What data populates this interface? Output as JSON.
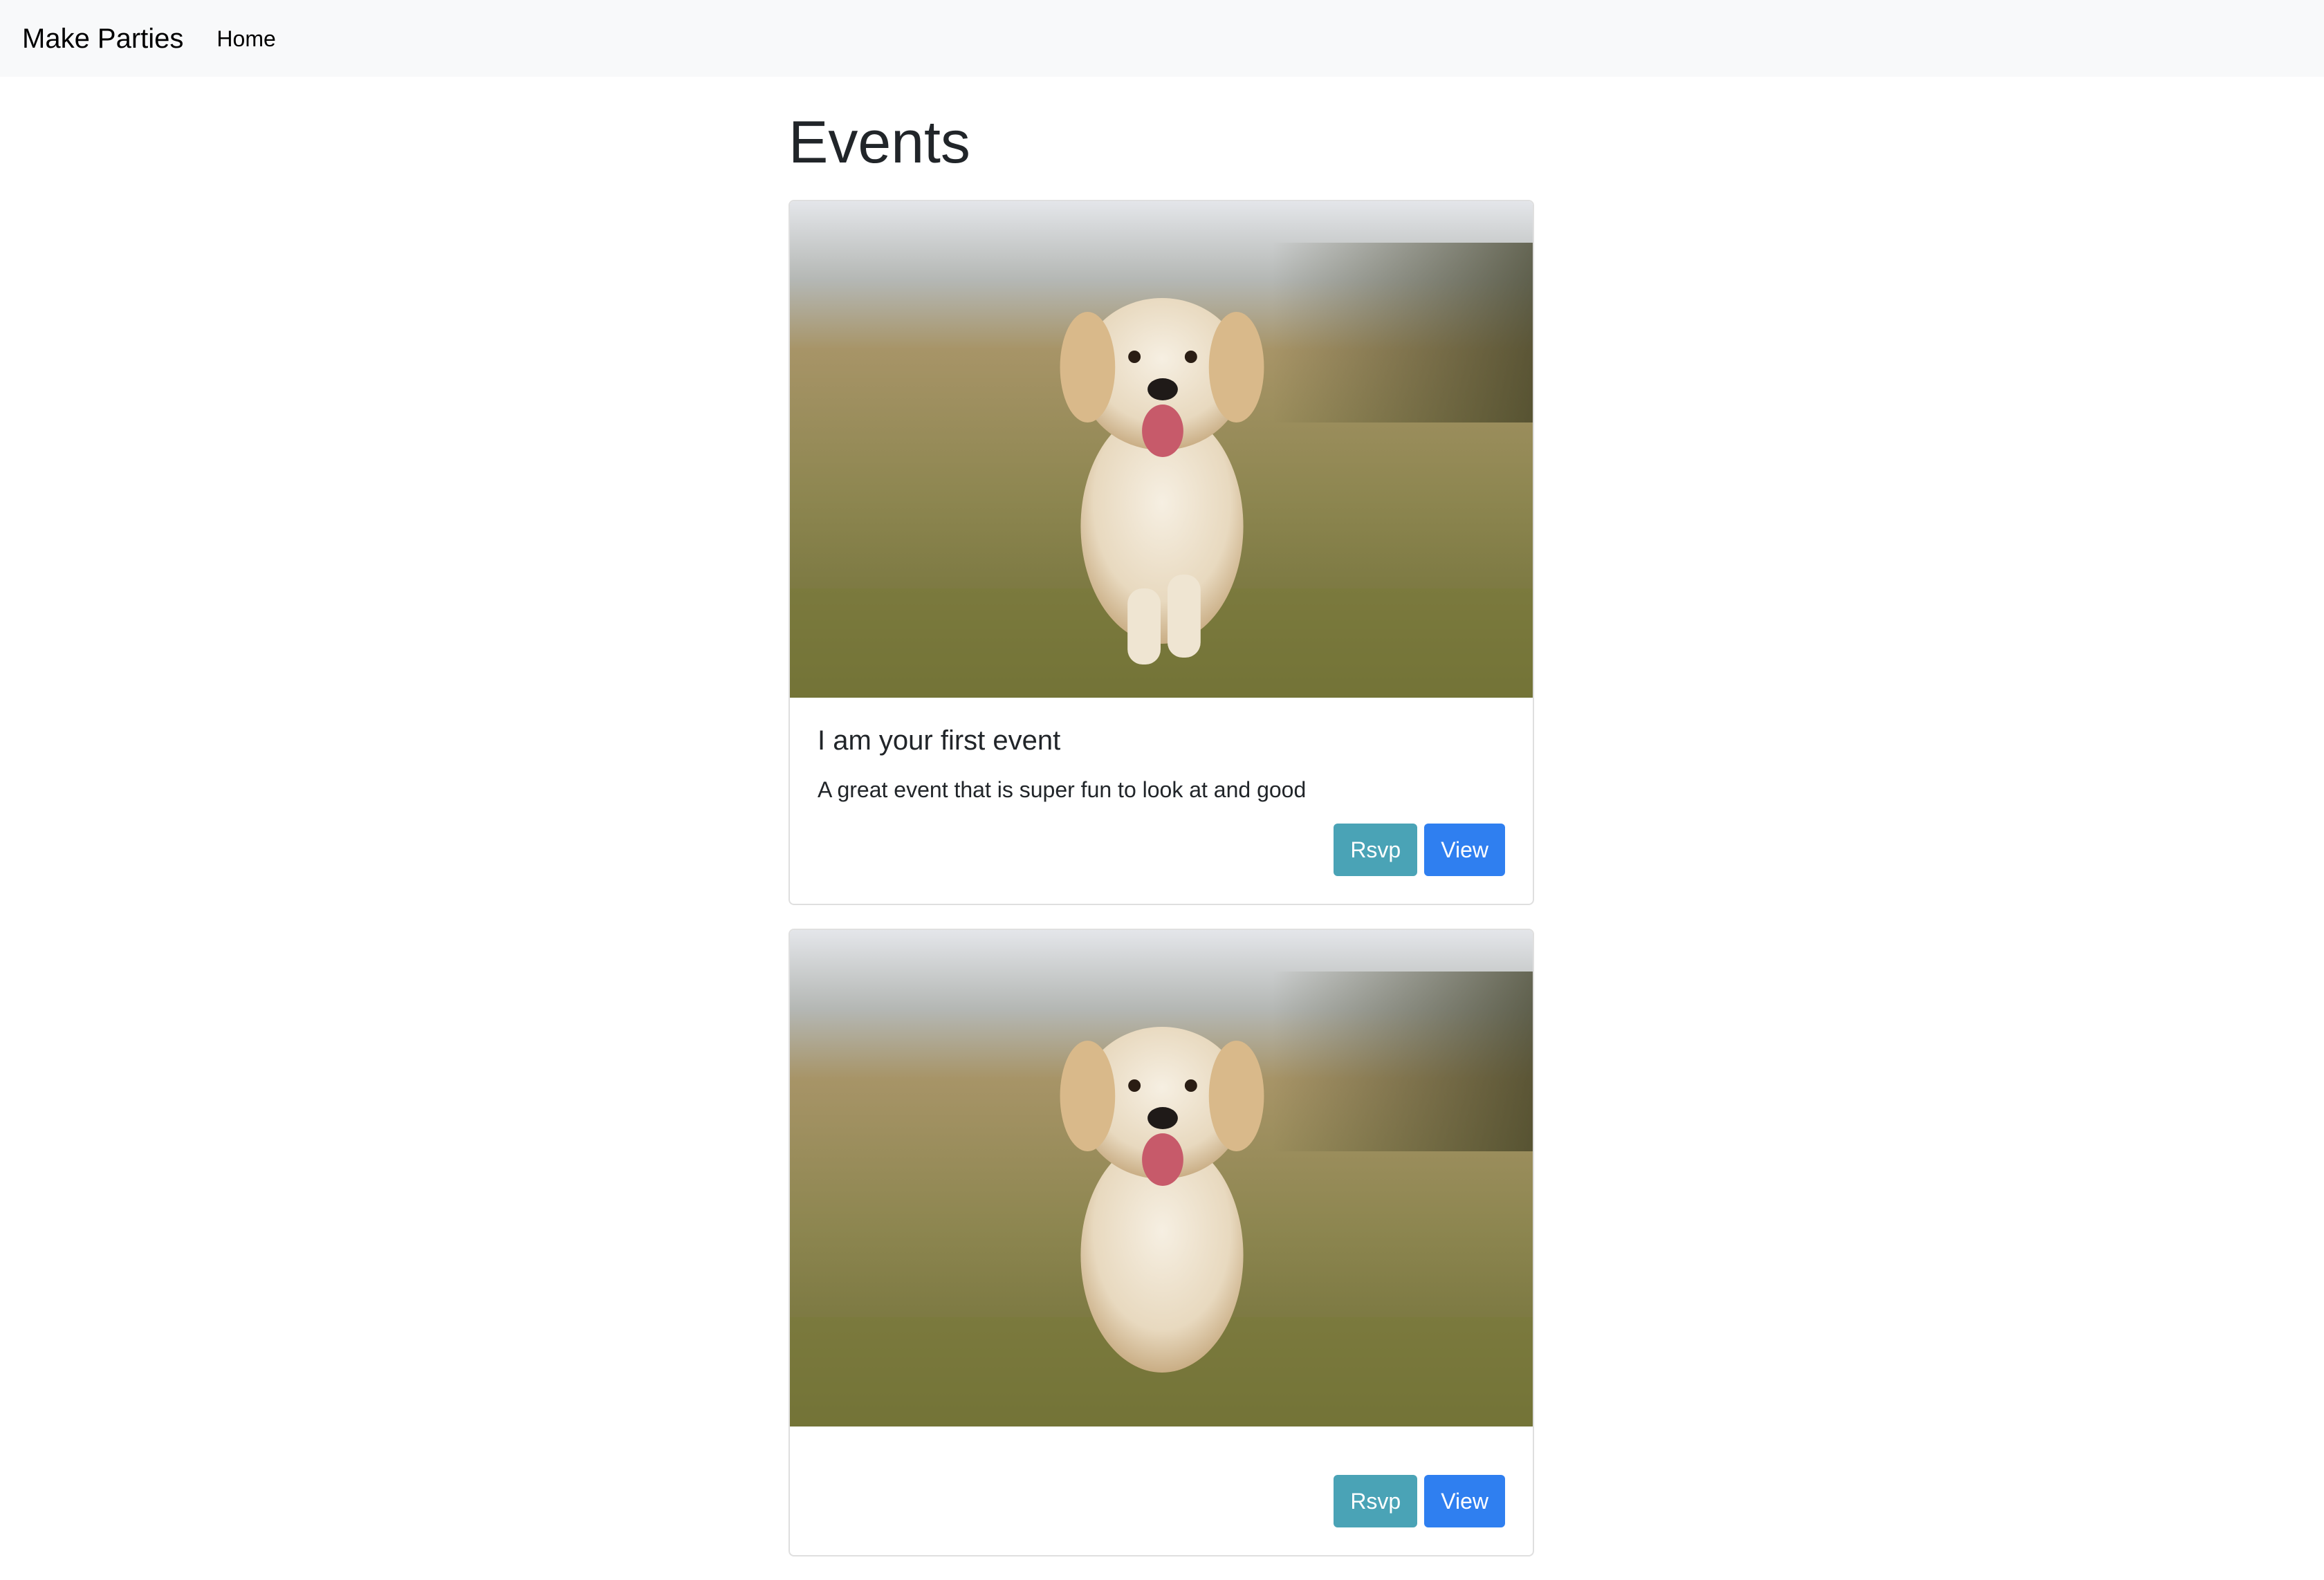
{
  "navbar": {
    "brand": "Make Parties",
    "links": [
      {
        "label": "Home"
      }
    ]
  },
  "main": {
    "title": "Events",
    "events": [
      {
        "title": "I am your first event",
        "description": "A great event that is super fun to look at and good",
        "image": "golden-retriever-puppy-running-on-grass",
        "rsvp_label": "Rsvp",
        "view_label": "View"
      },
      {
        "title": "",
        "description": "",
        "image": "golden-retriever-puppy-running-on-grass",
        "rsvp_label": "Rsvp",
        "view_label": "View"
      }
    ]
  },
  "colors": {
    "navbar_bg": "#f8f9fa",
    "rsvp_button": "#4aa3b6",
    "view_button": "#2f7ff0"
  }
}
